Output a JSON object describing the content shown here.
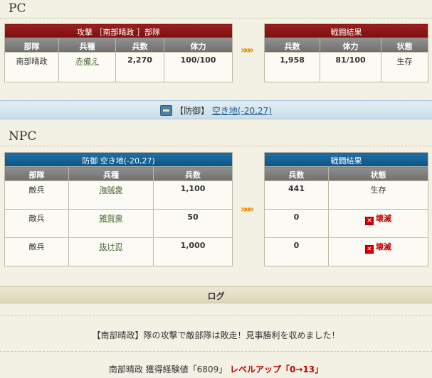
{
  "pc": {
    "heading": "PC",
    "attack_caption": "攻撃 ［南部晴政 ］部隊",
    "columns": [
      "部隊",
      "兵種",
      "兵数",
      "体力"
    ],
    "row": {
      "unit": "南部晴政",
      "type": "赤備え",
      "count": "2,270",
      "hp": "100/100"
    },
    "result_caption": "戦闘結果",
    "result_columns": [
      "兵数",
      "体力",
      "状態"
    ],
    "result_row": {
      "count": "1,958",
      "hp": "81/100",
      "status": "生存"
    }
  },
  "banner": {
    "prefix": "【防御】",
    "location": "空き地(-20,27)"
  },
  "npc": {
    "heading": "NPC",
    "defense_caption": "防御  空き地(-20,27)",
    "columns": [
      "部隊",
      "兵種",
      "兵数"
    ],
    "rows": [
      {
        "unit": "敵兵",
        "type": "海賊衆",
        "count": "1,100"
      },
      {
        "unit": "敵兵",
        "type": "雑賀衆",
        "count": "50"
      },
      {
        "unit": "敵兵",
        "type": "抜け忍",
        "count": "1,000"
      }
    ],
    "result_caption": "戦闘結果",
    "result_columns": [
      "兵数",
      "状態"
    ],
    "result_rows": [
      {
        "count": "441",
        "status": "生存"
      },
      {
        "count": "0",
        "status": "壊滅"
      },
      {
        "count": "0",
        "status": "壊滅"
      }
    ]
  },
  "arrows": "»»»",
  "log": {
    "title": "ログ",
    "message": "【南部晴政】隊の攻撃で敵部隊は敗走！見事勝利を収めました！",
    "exp_prefix": "南部晴政 獲得経験値「6809」",
    "levelup": "レベルアップ「0→13」"
  },
  "colors": {
    "attack": "#8b1414",
    "defense": "#0f5a8f",
    "destroy": "#c40000"
  }
}
